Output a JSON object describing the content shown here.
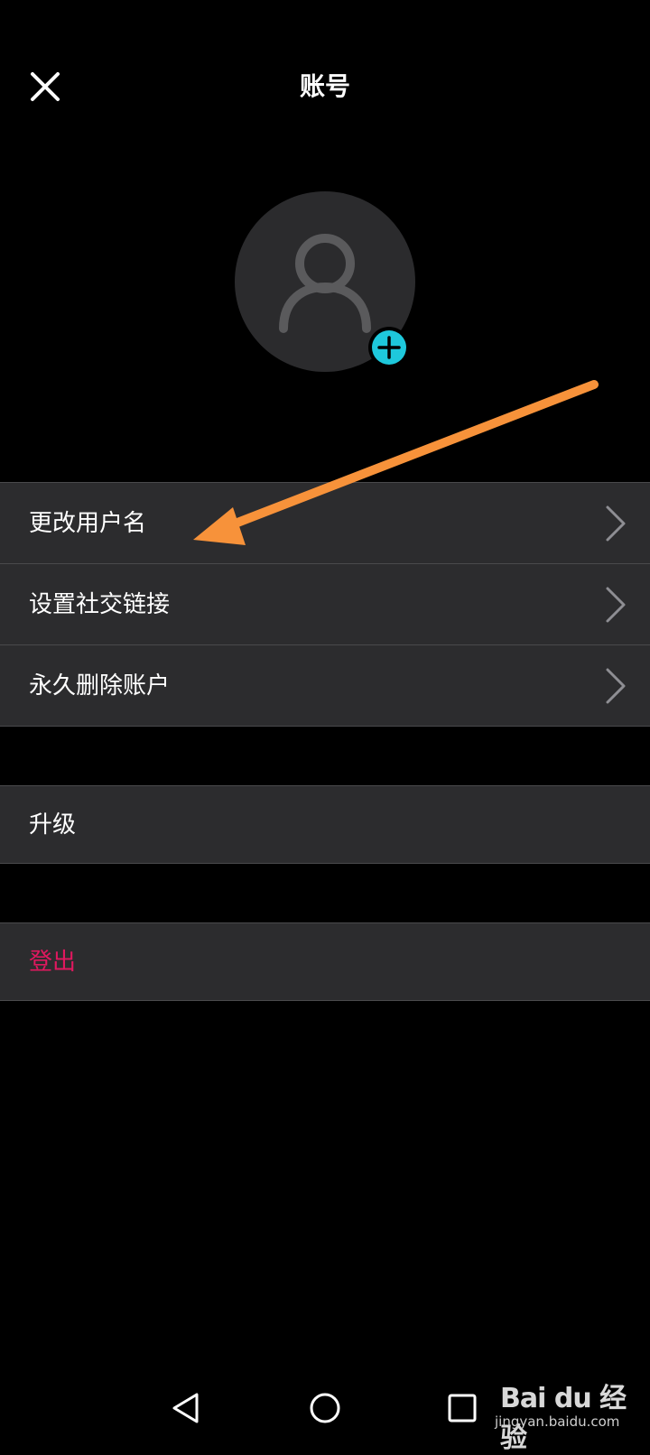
{
  "header": {
    "title": "账号",
    "close_icon": "close-icon"
  },
  "profile": {
    "avatar_icon": "user-icon",
    "add_icon": "plus-circle-icon",
    "add_color": "#1ec8dc"
  },
  "account_menu": [
    {
      "label": "更改用户名",
      "icon": "chevron-right-icon"
    },
    {
      "label": "设置社交链接",
      "icon": "chevron-right-icon"
    },
    {
      "label": "永久删除账户",
      "icon": "chevron-right-icon"
    }
  ],
  "upgrade": {
    "label": "升级"
  },
  "logout": {
    "label": "登出",
    "color": "#e0185f"
  },
  "annotation": {
    "arrow_color": "#f7923a",
    "icon": "arrow-annotation"
  },
  "system_nav": {
    "back_icon": "back-triangle-icon",
    "home_icon": "home-circle-icon",
    "recent_icon": "recent-square-icon"
  },
  "watermark": {
    "brand": "Bai du 经验",
    "url": "jingyan.baidu.com"
  }
}
